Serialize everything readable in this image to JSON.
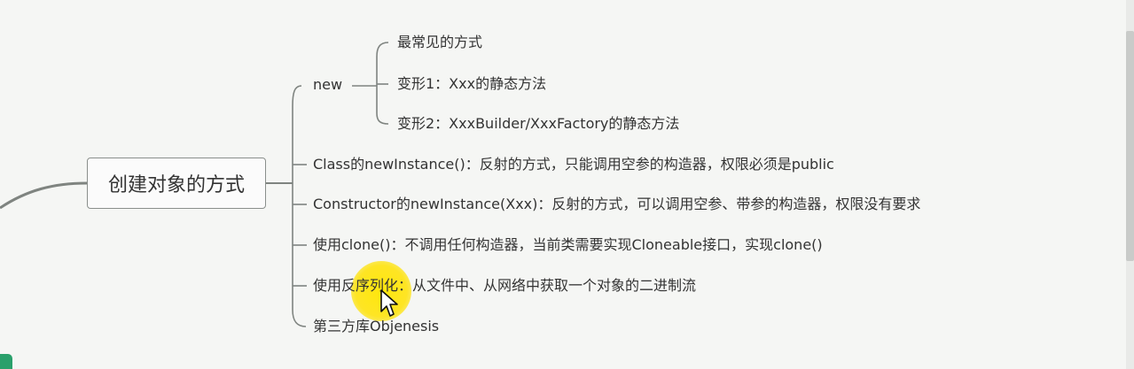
{
  "mindmap": {
    "root": "创建对象的方式",
    "branches": [
      {
        "label": "new",
        "children": [
          "最常见的方式",
          "变形1：Xxx的静态方法",
          "变形2：XxxBuilder/XxxFactory的静态方法"
        ]
      },
      {
        "label": "Class的newInstance()：反射的方式，只能调用空参的构造器，权限必须是public"
      },
      {
        "label": "Constructor的newInstance(Xxx)：反射的方式，可以调用空参、带参的构造器，权限没有要求"
      },
      {
        "label": "使用clone()：不调用任何构造器，当前类需要实现Cloneable接口，实现clone()"
      },
      {
        "label": "使用反序列化：从文件中、从网络中获取一个对象的二进制流"
      },
      {
        "label": "第三方库Objenesis"
      }
    ]
  },
  "colors": {
    "connector": "#7f8480",
    "highlight": "#ffe400",
    "accent_tab": "#2aa06b"
  },
  "icons": {
    "cursor": "mouse-pointer-icon"
  }
}
